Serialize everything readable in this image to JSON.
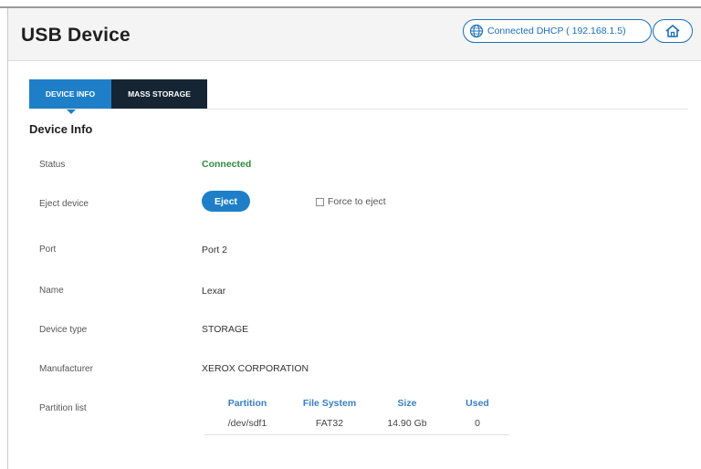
{
  "header": {
    "title": "USB Device",
    "connection_status": "Connected DHCP ( 192.168.1.5)",
    "globe_icon": "globe-icon",
    "home_icon": "home-icon"
  },
  "tabs": [
    {
      "label": "DEVICE INFO",
      "active": true
    },
    {
      "label": "MASS STORAGE",
      "active": false
    }
  ],
  "section": {
    "title": "Device Info"
  },
  "rows": {
    "status": {
      "label": "Status",
      "value": "Connected"
    },
    "eject": {
      "label": "Eject device",
      "button": "Eject",
      "force_label": "Force to eject",
      "force_checked": false
    },
    "port": {
      "label": "Port",
      "value": "Port 2"
    },
    "name": {
      "label": "Name",
      "value": "Lexar"
    },
    "device_type": {
      "label": "Device type",
      "value": "STORAGE"
    },
    "manufacturer": {
      "label": "Manufacturer",
      "value": "XEROX CORPORATION"
    },
    "partition_list": {
      "label": "Partition list"
    }
  },
  "partition_table": {
    "headers": [
      "Partition",
      "File System",
      "Size",
      "Used"
    ],
    "rows": [
      [
        "/dev/sdf1",
        "FAT32",
        "14.90 Gb",
        "0"
      ]
    ]
  },
  "colors": {
    "accent": "#1e7fc8",
    "tab_inactive": "#152533",
    "status_ok": "#2e8b3a",
    "header_link": "#1a6fb7"
  }
}
